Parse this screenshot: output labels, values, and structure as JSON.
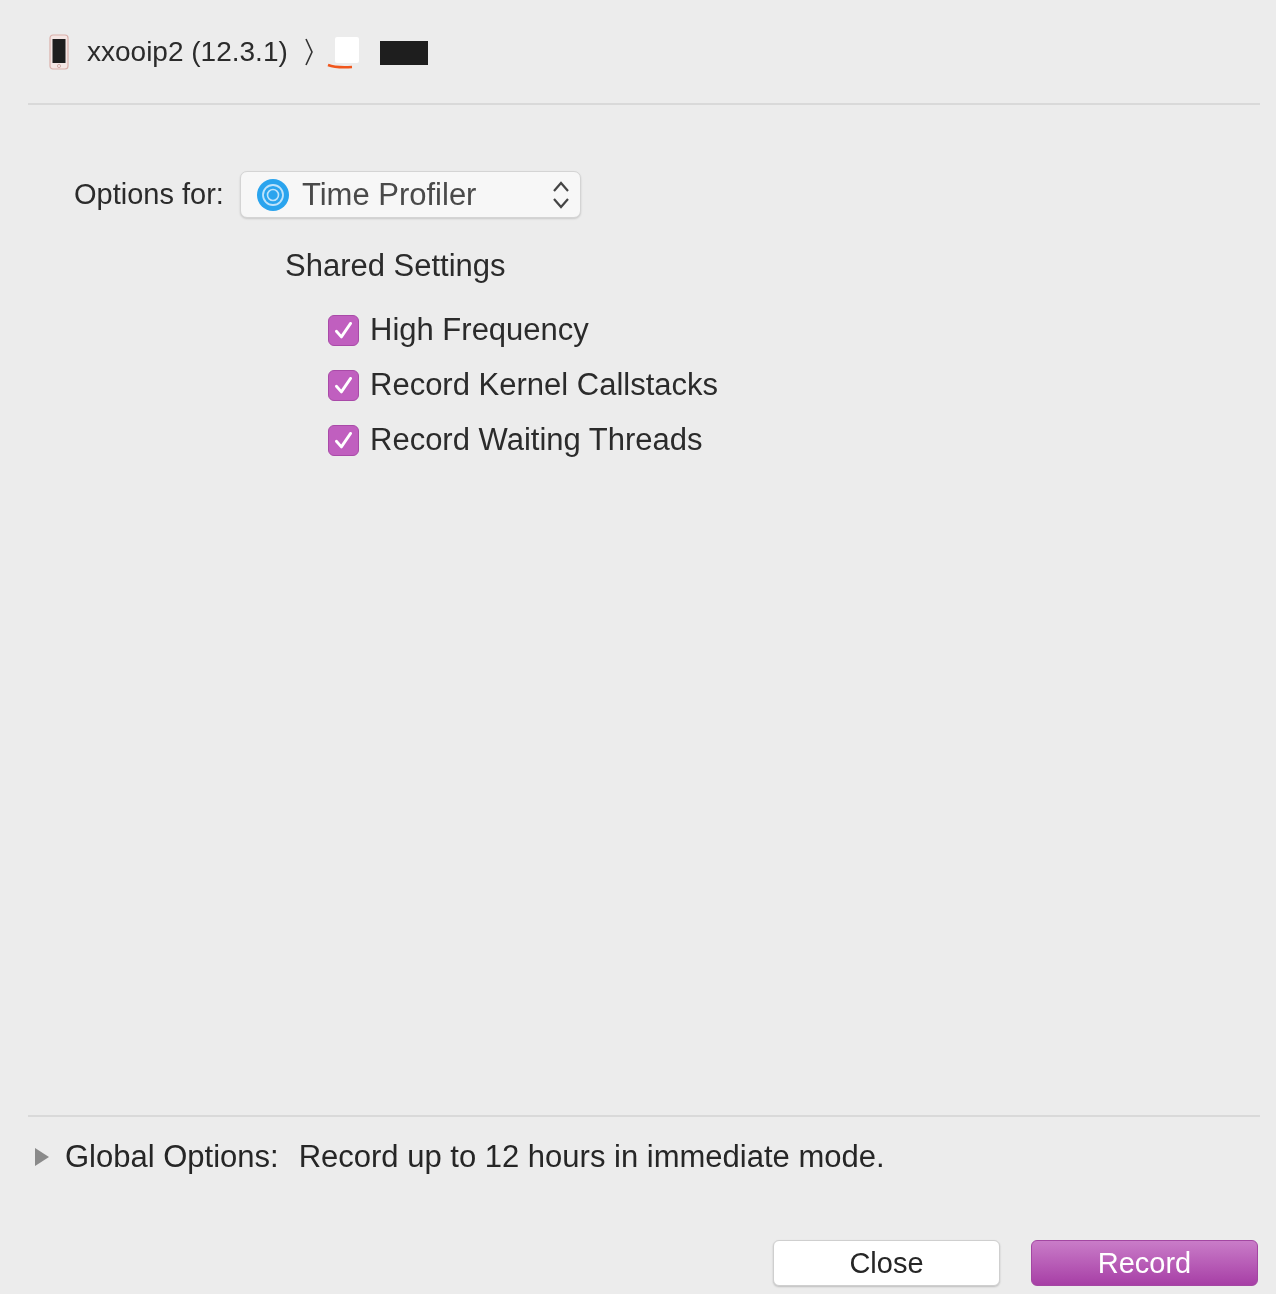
{
  "header": {
    "device_name": "xxooip2 (12.3.1)"
  },
  "options_for": {
    "label": "Options for:",
    "template": "Time Profiler"
  },
  "section_title": "Shared Settings",
  "settings": [
    {
      "label": "High Frequency",
      "checked": true
    },
    {
      "label": "Record Kernel Callstacks",
      "checked": true
    },
    {
      "label": "Record Waiting Threads",
      "checked": true
    }
  ],
  "global_options": {
    "expanded": false,
    "label": "Global Options:",
    "summary": "Record up to 12 hours in immediate mode."
  },
  "buttons": [
    {
      "label": "Close",
      "kind": "default"
    },
    {
      "label": "Record",
      "kind": "primary"
    }
  ]
}
